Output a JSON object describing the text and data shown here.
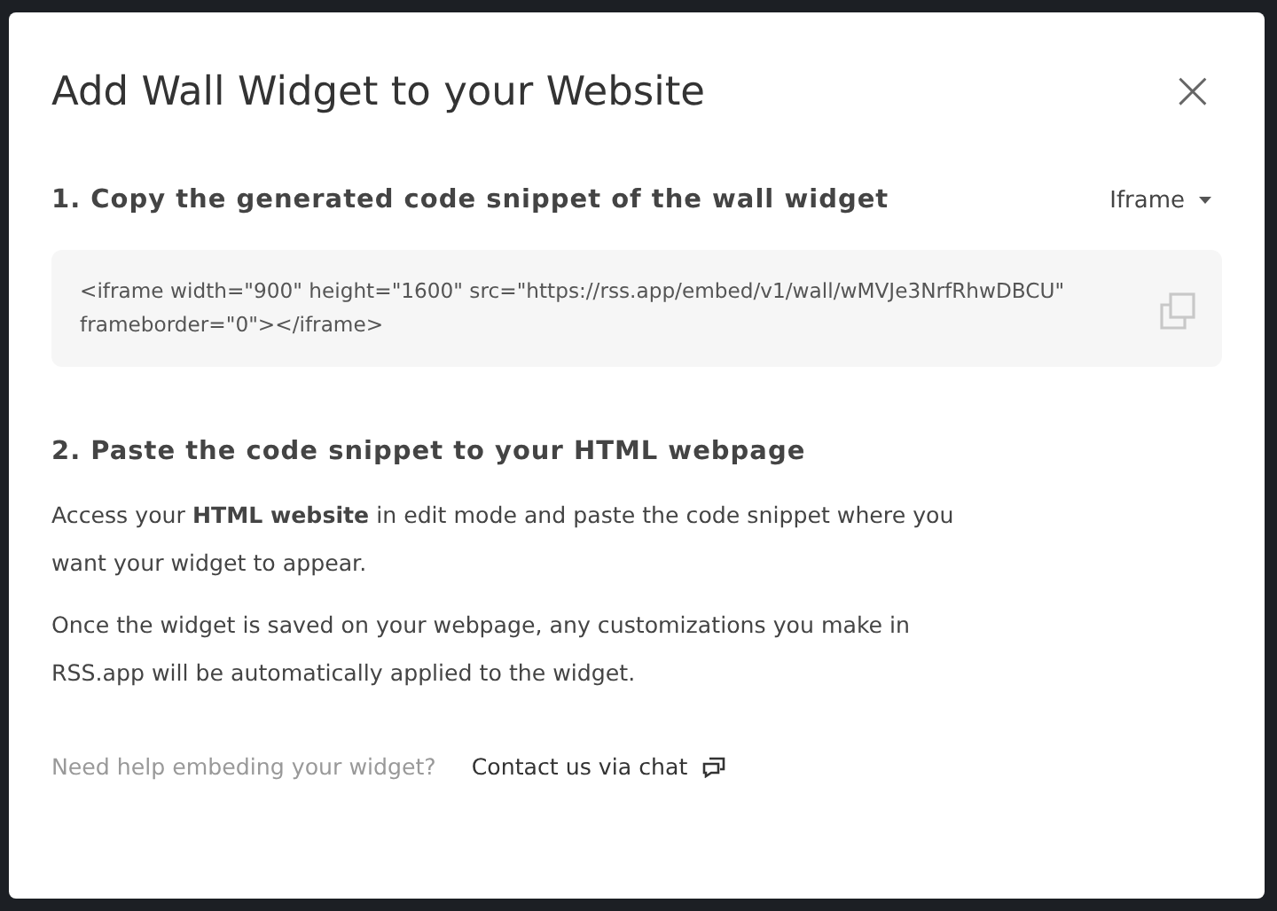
{
  "dialog": {
    "title": "Add Wall Widget to your Website",
    "close": "×"
  },
  "step_1": {
    "heading": "1. Copy the generated code snippet of the wall widget",
    "format_dropdown": "Iframe",
    "code": "<iframe width=\"900\" height=\"1600\" src=\"https://rss.app/embed/v1/wall/wMVJe3NrfRhwDBCU\" frameborder=\"0\"></iframe>"
  },
  "step_2": {
    "heading": "2. Paste the code snippet to your HTML webpage",
    "paragraphs": [
      "Access your **HTML website** in edit mode and paste the code snippet where you want your widget to appear.",
      "Once the widget is saved on your webpage, any customizations you make in RSS.app will be automatically applied to the widget."
    ]
  },
  "help": {
    "question": "Need help embeding your widget?",
    "link": "Contact us via chat"
  }
}
